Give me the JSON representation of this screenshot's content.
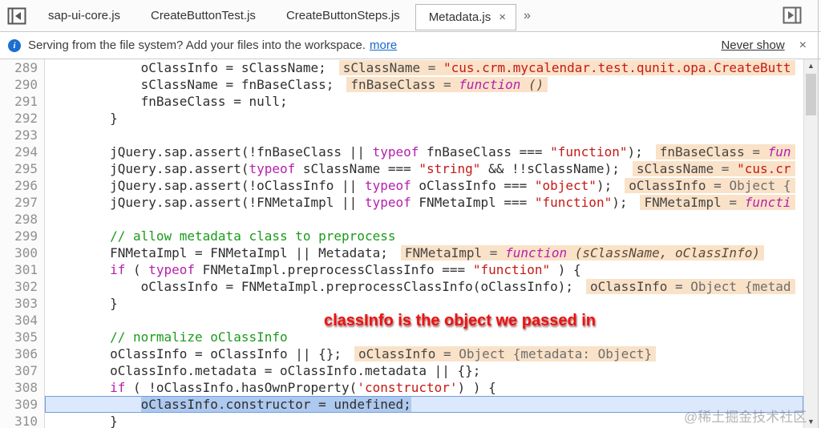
{
  "tabbar": {
    "tabs": [
      {
        "label": "sap-ui-core.js",
        "active": false
      },
      {
        "label": "CreateButtonTest.js",
        "active": false
      },
      {
        "label": "CreateButtonSteps.js",
        "active": false
      },
      {
        "label": "Metadata.js",
        "active": true,
        "close_label": "×"
      }
    ],
    "overflow_label": "»"
  },
  "infobar": {
    "message": "Serving from the file system? Add your files into the workspace.",
    "more_label": "more",
    "never_show_label": "Never show",
    "close_label": "×",
    "icon_glyph": "i"
  },
  "annotation": {
    "text": "classInfo is the object we passed in"
  },
  "watermark": {
    "text": "@稀土掘金技术社区"
  },
  "colors": {
    "widget_bg": "#fae2c8",
    "selection_text_bg": "#aec9ef",
    "selection_row_bg": "#dce8fb",
    "selection_border": "#6e9fe0",
    "annotation_red": "#ee1111",
    "link_blue": "#1a66c9",
    "keyword_purple": "#b520ac",
    "string_red": "#c41a16",
    "comment_green": "#1a9b1a"
  },
  "editor": {
    "lines": [
      {
        "num": 289,
        "tokens": [
          {
            "t": "            oClassInfo = sClassName;",
            "c": "p"
          }
        ],
        "widget": [
          {
            "t": "sClassName",
            "c": "wn"
          },
          {
            "t": " = ",
            "c": "wp"
          },
          {
            "t": "\"cus.crm.mycalendar.test.qunit.opa.CreateButt",
            "c": "ws"
          }
        ]
      },
      {
        "num": 290,
        "tokens": [
          {
            "t": "            sClassName = fnBaseClass;",
            "c": "p"
          }
        ],
        "widget": [
          {
            "t": "fnBaseClass",
            "c": "wn"
          },
          {
            "t": " = ",
            "c": "wp"
          },
          {
            "t": "function",
            "c": "wf"
          },
          {
            "t": " ()",
            "c": "wi"
          }
        ]
      },
      {
        "num": 291,
        "tokens": [
          {
            "t": "            fnBaseClass = null;",
            "c": "p"
          }
        ]
      },
      {
        "num": 292,
        "tokens": [
          {
            "t": "        }",
            "c": "p"
          }
        ]
      },
      {
        "num": 293,
        "tokens": []
      },
      {
        "num": 294,
        "tokens": [
          {
            "t": "        jQuery.sap.assert(!fnBaseClass || ",
            "c": "p"
          },
          {
            "t": "typeof",
            "c": "k"
          },
          {
            "t": " fnBaseClass === ",
            "c": "p"
          },
          {
            "t": "\"function\"",
            "c": "s"
          },
          {
            "t": ");",
            "c": "p"
          }
        ],
        "widget": [
          {
            "t": "fnBaseClass",
            "c": "wn"
          },
          {
            "t": " = ",
            "c": "wp"
          },
          {
            "t": "fun",
            "c": "wf"
          }
        ]
      },
      {
        "num": 295,
        "tokens": [
          {
            "t": "        jQuery.sap.assert(",
            "c": "p"
          },
          {
            "t": "typeof",
            "c": "k"
          },
          {
            "t": " sClassName === ",
            "c": "p"
          },
          {
            "t": "\"string\"",
            "c": "s"
          },
          {
            "t": " && !!sClassName);",
            "c": "p"
          }
        ],
        "widget": [
          {
            "t": "sClassName",
            "c": "wn"
          },
          {
            "t": " = ",
            "c": "wp"
          },
          {
            "t": "\"cus.cr",
            "c": "ws"
          }
        ]
      },
      {
        "num": 296,
        "tokens": [
          {
            "t": "        jQuery.sap.assert(!oClassInfo || ",
            "c": "p"
          },
          {
            "t": "typeof",
            "c": "k"
          },
          {
            "t": " oClassInfo === ",
            "c": "p"
          },
          {
            "t": "\"object\"",
            "c": "s"
          },
          {
            "t": ");",
            "c": "p"
          }
        ],
        "widget": [
          {
            "t": "oClassInfo",
            "c": "wn"
          },
          {
            "t": " = ",
            "c": "wp"
          },
          {
            "t": "Object {",
            "c": "wv"
          }
        ]
      },
      {
        "num": 297,
        "tokens": [
          {
            "t": "        jQuery.sap.assert(!FNMetaImpl || ",
            "c": "p"
          },
          {
            "t": "typeof",
            "c": "k"
          },
          {
            "t": " FNMetaImpl === ",
            "c": "p"
          },
          {
            "t": "\"function\"",
            "c": "s"
          },
          {
            "t": ");",
            "c": "p"
          }
        ],
        "widget": [
          {
            "t": "FNMetaImpl",
            "c": "wn"
          },
          {
            "t": " = ",
            "c": "wp"
          },
          {
            "t": "functi",
            "c": "wf"
          }
        ]
      },
      {
        "num": 298,
        "tokens": []
      },
      {
        "num": 299,
        "tokens": [
          {
            "t": "        // allow metadata class to preprocess",
            "c": "c"
          }
        ]
      },
      {
        "num": 300,
        "tokens": [
          {
            "t": "        FNMetaImpl = FNMetaImpl || Metadata;",
            "c": "p"
          }
        ],
        "widget": [
          {
            "t": "FNMetaImpl",
            "c": "wn"
          },
          {
            "t": " = ",
            "c": "wp"
          },
          {
            "t": "function",
            "c": "wf"
          },
          {
            "t": " (sClassName, oClassInfo)",
            "c": "wi"
          }
        ]
      },
      {
        "num": 301,
        "tokens": [
          {
            "t": "        ",
            "c": "p"
          },
          {
            "t": "if",
            "c": "k"
          },
          {
            "t": " ( ",
            "c": "p"
          },
          {
            "t": "typeof",
            "c": "k"
          },
          {
            "t": " FNMetaImpl.preprocessClassInfo === ",
            "c": "p"
          },
          {
            "t": "\"function\"",
            "c": "s"
          },
          {
            "t": " ) {",
            "c": "p"
          }
        ]
      },
      {
        "num": 302,
        "tokens": [
          {
            "t": "            oClassInfo = FNMetaImpl.preprocessClassInfo(oClassInfo);",
            "c": "p"
          }
        ],
        "widget": [
          {
            "t": "oClassInfo",
            "c": "wn"
          },
          {
            "t": " = ",
            "c": "wp"
          },
          {
            "t": "Object {metad",
            "c": "wv"
          }
        ]
      },
      {
        "num": 303,
        "tokens": [
          {
            "t": "        }",
            "c": "p"
          }
        ]
      },
      {
        "num": 304,
        "tokens": []
      },
      {
        "num": 305,
        "tokens": [
          {
            "t": "        // normalize oClassInfo",
            "c": "c"
          }
        ]
      },
      {
        "num": 306,
        "tokens": [
          {
            "t": "        oClassInfo = oClassInfo || {};",
            "c": "p"
          }
        ],
        "widget": [
          {
            "t": "oClassInfo",
            "c": "wn"
          },
          {
            "t": " = ",
            "c": "wp"
          },
          {
            "t": "Object {metadata: Object}",
            "c": "wv"
          }
        ]
      },
      {
        "num": 307,
        "tokens": [
          {
            "t": "        oClassInfo.metadata = oClassInfo.metadata || {};",
            "c": "p"
          }
        ]
      },
      {
        "num": 308,
        "tokens": [
          {
            "t": "        ",
            "c": "p"
          },
          {
            "t": "if",
            "c": "k"
          },
          {
            "t": " ( !oClassInfo.hasOwnProperty(",
            "c": "p"
          },
          {
            "t": "'constructor'",
            "c": "s"
          },
          {
            "t": ") ) {",
            "c": "p"
          }
        ]
      },
      {
        "num": 309,
        "selected": true,
        "tokens": [
          {
            "t": "            ",
            "c": "p"
          },
          {
            "t": "oClassInfo.constructor = undefined;",
            "c": "p",
            "sel": true
          }
        ]
      },
      {
        "num": 310,
        "tokens": [
          {
            "t": "        }",
            "c": "p"
          }
        ]
      }
    ]
  }
}
